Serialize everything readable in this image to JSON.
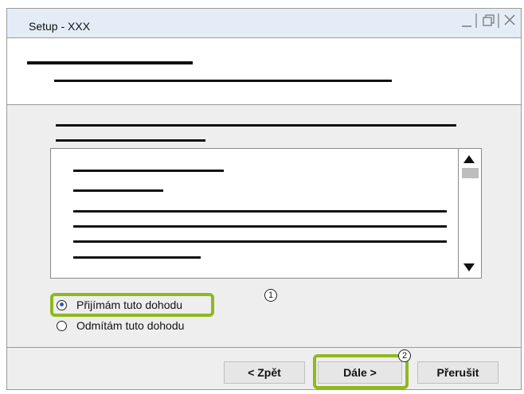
{
  "window": {
    "title": "Setup - XXX",
    "controls": [
      "minimize-icon",
      "restore-icon",
      "close-icon"
    ]
  },
  "license": {
    "options": [
      {
        "label": "Přijímám tuto dohodu",
        "selected": true
      },
      {
        "label": "Odmítám tuto dohodu",
        "selected": false
      }
    ]
  },
  "buttons": {
    "back": "< Zpět",
    "next": "Dále >",
    "cancel": "Přerušit"
  },
  "callouts": {
    "step1": "1",
    "step2": "2"
  },
  "colors": {
    "titlebar": "#e3ecf7",
    "highlight": "#8fb81e",
    "radio_dot": "#2a5fb3"
  }
}
